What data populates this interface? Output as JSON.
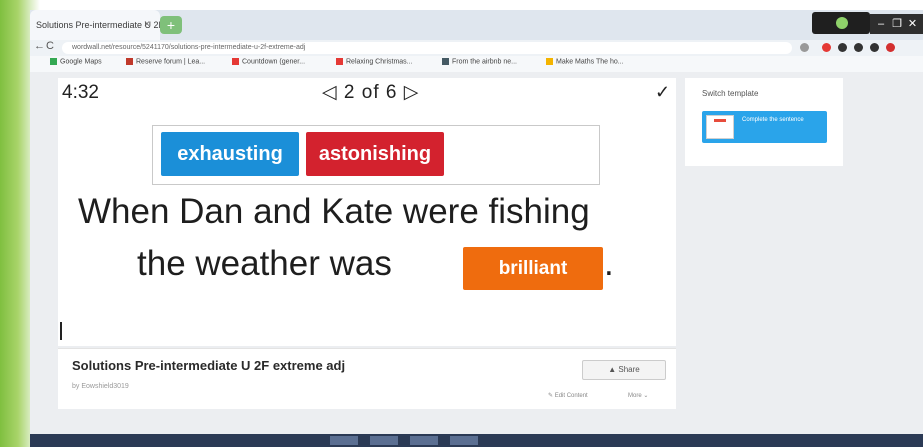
{
  "browser": {
    "tab_title": "Solutions Pre-intermediate U 2F",
    "tab_close": "×",
    "new_tab": "+",
    "url": "wordwall.net/resource/5241170/solutions-pre-intermediate-u-2f-extreme-adj",
    "back_icon": "←",
    "reload_icon": "C",
    "bookmarks": [
      {
        "label": "Google Maps",
        "color": "#34a853"
      },
      {
        "label": "Reserve forum | Lea...",
        "color": "#c0392b"
      },
      {
        "label": "Countdown (gener...",
        "color": "#e53935"
      },
      {
        "label": "Relaxing Christmas...",
        "color": "#e53935"
      },
      {
        "label": "From the airbnb ne...",
        "color": "#455a64"
      },
      {
        "label": "Make Maths The ho...",
        "color": "#f4b400"
      }
    ],
    "window_controls": [
      "–",
      "❐",
      "✕"
    ]
  },
  "game": {
    "timer": "4:32",
    "pager": {
      "prev": "◁",
      "text": "2 of 6",
      "next": "▷"
    },
    "check_icon": "✓",
    "answer_tiles": [
      {
        "label": "exhausting",
        "color": "#1b8fd8"
      },
      {
        "label": "astonishing",
        "color": "#d3222e"
      }
    ],
    "sentence_line1": "When Dan and Kate were fishing",
    "sentence_line2": "the weather was",
    "placed_tile": {
      "label": "brilliant",
      "color": "#ef6c0e"
    },
    "sentence_end": "."
  },
  "activity": {
    "title": "Solutions Pre-intermediate U 2F extreme adj",
    "author": "by Eowshield3019",
    "share_label": "Share",
    "edit_label": "Edit Content",
    "more_label": "More"
  },
  "sidebar": {
    "switch_label": "Switch template",
    "template_label": "Complete the sentence"
  }
}
